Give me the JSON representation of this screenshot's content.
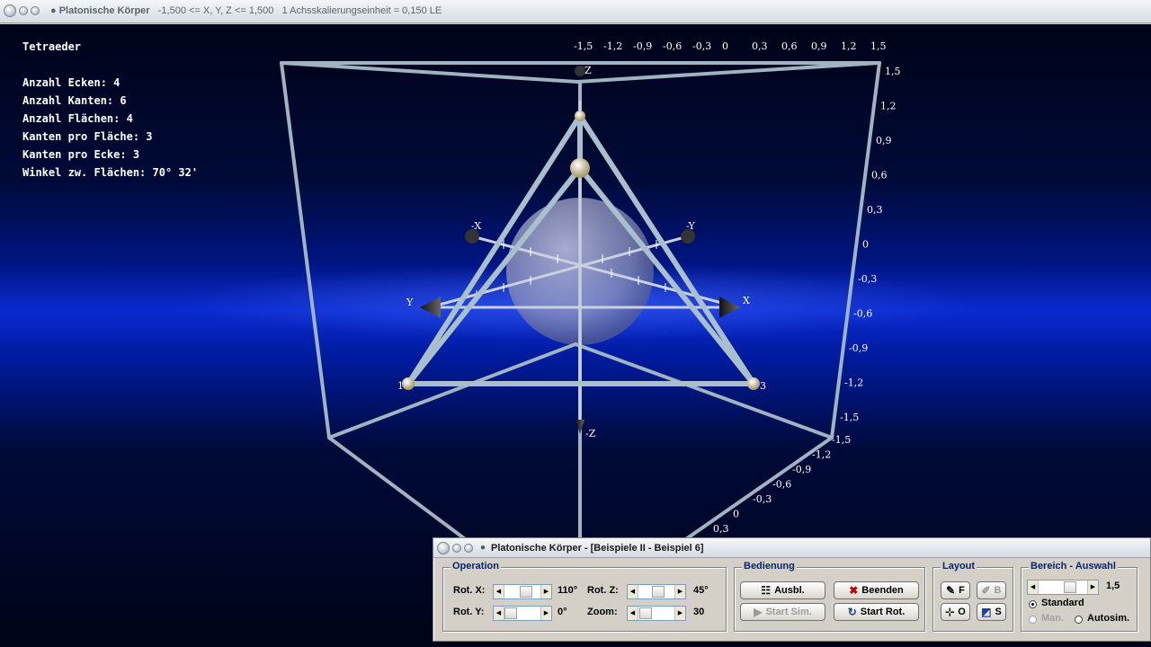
{
  "window": {
    "title": "Platonische Körper",
    "range_text": "-1,500 <= X, Y, Z <= 1,500",
    "unit_text": "1 Achsskalierungseinheit = 0,150 LE"
  },
  "info": {
    "solid_name": "Tetraeder",
    "lines": [
      "Anzahl Ecken: 4",
      "Anzahl Kanten: 6",
      "Anzahl Flächen: 4",
      "Kanten pro Fläche: 3",
      "Kanten pro Ecke: 3",
      "Winkel zw. Flächen: 70° 32'"
    ]
  },
  "scene": {
    "top_ticks": [
      "-1,5",
      "-1,2",
      "-0,9",
      "-0,6",
      "-0,3",
      "0",
      "0,3",
      "0,6",
      "0,9",
      "1,2",
      "1,5"
    ],
    "right_ticks": [
      "1,5",
      "1,2",
      "0,9",
      "0,6",
      "0,3",
      "0",
      "-0,3",
      "-0,6",
      "-0,9",
      "-1,2",
      "-1,5"
    ],
    "bottom_ticks": [
      "-1,5",
      "-1,2",
      "-0,9",
      "-0,6",
      "-0,3",
      "0",
      "0,3"
    ],
    "axis_labels": {
      "z_pos": "Z",
      "z_neg": "-Z",
      "x_pos": "X",
      "x_neg": "-X",
      "y_pos": "Y",
      "y_neg": "-Y"
    },
    "vertex_labels": [
      "1",
      "3"
    ],
    "colors": {
      "edge": "#a9c0cc",
      "sphere": "#8e92b8",
      "vertex": "#e6d9a8"
    }
  },
  "panel": {
    "title": "Platonische Körper - [Beispiele II - Beispiel 6]",
    "operation": {
      "title": "Operation",
      "rot_x_label": "Rot. X:",
      "rot_x_value": "110°",
      "rot_y_label": "Rot. Y:",
      "rot_y_value": "0°",
      "rot_z_label": "Rot. Z:",
      "rot_z_value": "45°",
      "zoom_label": "Zoom:",
      "zoom_value": "30"
    },
    "bedienung": {
      "title": "Bedienung",
      "ausbl": "Ausbl.",
      "beenden": "Beenden",
      "start_sim": "Start Sim.",
      "start_rot": "Start Rot."
    },
    "layout": {
      "title": "Layout",
      "f": "F",
      "b": "B",
      "o": "O",
      "s": "S"
    },
    "bereich": {
      "title": "Bereich - Auswahl",
      "value": "1,5",
      "standard": "Standard",
      "man": "Man.",
      "autosim": "Autosim."
    }
  }
}
